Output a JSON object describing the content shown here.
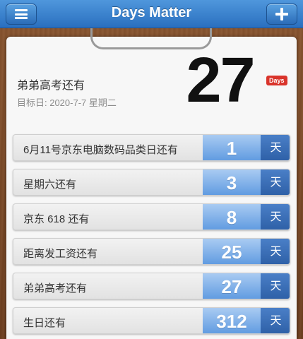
{
  "app": {
    "title": "Days Matter"
  },
  "toolbar": {
    "menu_icon": "menu-icon",
    "add_icon": "plus-icon"
  },
  "hero": {
    "title": "弟弟高考还有",
    "date": "目标日: 2020-7-7 星期二",
    "count": "27",
    "badge": "Days"
  },
  "events": [
    {
      "label": "6月11号京东电脑数码品类日还有",
      "count": "1",
      "unit": "天"
    },
    {
      "label": "星期六还有",
      "count": "3",
      "unit": "天"
    },
    {
      "label": "京东 618 还有",
      "count": "8",
      "unit": "天"
    },
    {
      "label": "距离发工资还有",
      "count": "25",
      "unit": "天"
    },
    {
      "label": "弟弟高考还有",
      "count": "27",
      "unit": "天"
    },
    {
      "label": "生日还有",
      "count": "312",
      "unit": "天"
    }
  ],
  "colors": {
    "topbar": "#2a6fbf",
    "count_cell": "#5d99e0",
    "unit_cell": "#2d5fa6",
    "badge": "#d9342b"
  }
}
